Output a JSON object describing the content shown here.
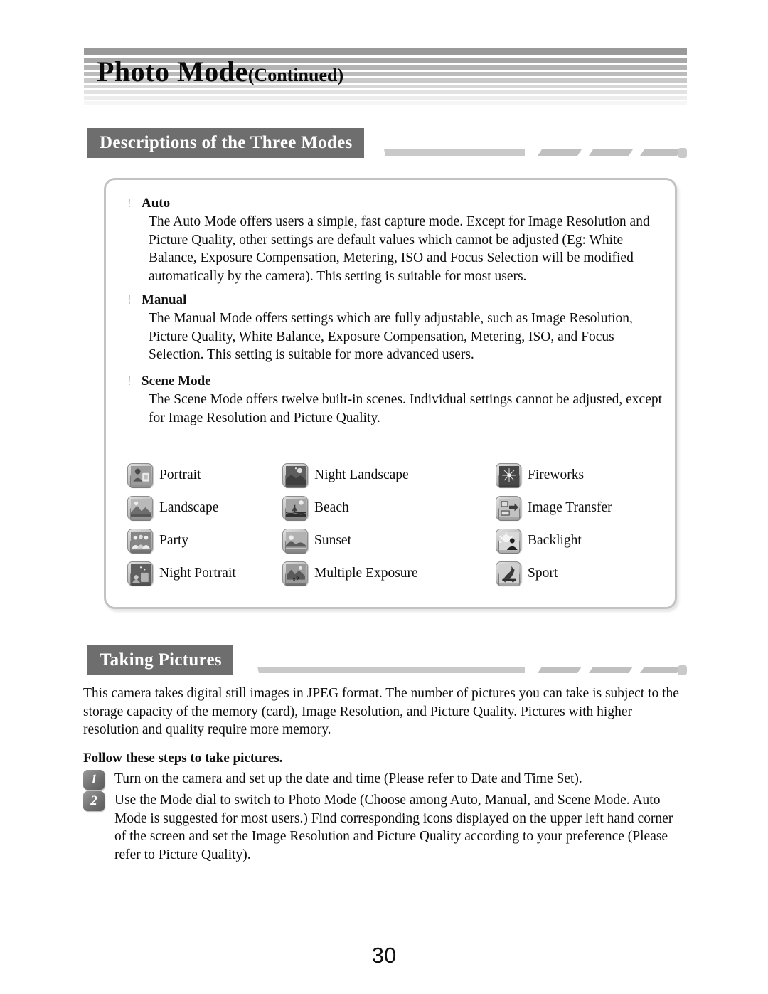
{
  "page": {
    "title_main": "Photo Mode",
    "title_sub": "(Continued)",
    "number": "30"
  },
  "sections": [
    {
      "id": "descriptions",
      "label": "Descriptions of the Three Modes"
    },
    {
      "id": "taking_pictures",
      "label": "Taking Pictures"
    }
  ],
  "modes": [
    {
      "marker": "!",
      "name": "Auto",
      "description": "The Auto Mode offers users a simple, fast capture mode. Except for Image Resolution and Picture Quality, other settings are default values which cannot be adjusted (Eg: White Balance, Exposure Compensation, Metering, ISO and Focus Selection will be modified automatically by the camera). This setting is suitable for most users."
    },
    {
      "marker": "!",
      "name": "Manual",
      "description": "The Manual Mode offers settings which are fully adjustable, such as Image Resolution, Picture Quality, White Balance, Exposure Compensation, Metering, ISO, and Focus Selection. This setting is suitable for more advanced users."
    },
    {
      "marker": "!",
      "name": "Scene Mode",
      "description": "The Scene Mode offers twelve built-in scenes. Individual settings cannot be adjusted, except for Image Resolution and Picture Quality."
    }
  ],
  "scene_icons": {
    "columns": [
      [
        {
          "icon": "portrait-scene-icon",
          "label": "Portrait"
        },
        {
          "icon": "landscape-scene-icon",
          "label": "Landscape"
        },
        {
          "icon": "party-scene-icon",
          "label": "Party"
        },
        {
          "icon": "night-portrait-scene-icon",
          "label": "Night Portrait"
        }
      ],
      [
        {
          "icon": "night-landscape-scene-icon",
          "label": "Night Landscape"
        },
        {
          "icon": "beach-scene-icon",
          "label": "Beach"
        },
        {
          "icon": "sunset-scene-icon",
          "label": "Sunset"
        },
        {
          "icon": "multiple-exposure-scene-icon",
          "label": "Multiple Exposure"
        }
      ],
      [
        {
          "icon": "fireworks-scene-icon",
          "label": "Fireworks"
        },
        {
          "icon": "image-transfer-scene-icon",
          "label": "Image Transfer"
        },
        {
          "icon": "backlight-scene-icon",
          "label": "Backlight"
        },
        {
          "icon": "sport-scene-icon",
          "label": "Sport"
        }
      ]
    ]
  },
  "taking_pictures": {
    "intro": "This camera takes digital still images in JPEG format. The number of pictures you can take is subject to the storage capacity of the memory (card), Image Resolution, and Picture Quality. Pictures with higher resolution and quality require more memory.",
    "steps_lead": "Follow these steps to take pictures.",
    "steps": [
      {
        "num": "1",
        "text": "Turn on the camera and set up the date and time (Please refer to Date and Time Set)."
      },
      {
        "num": "2",
        "text": "Use the Mode dial to switch to Photo Mode (Choose among Auto, Manual, and Scene Mode. Auto Mode is suggested for most users.) Find corresponding icons displayed on the upper left hand corner of the screen and set the Image Resolution and Picture Quality according to your preference (Please refer to Picture Quality)."
      }
    ]
  },
  "colors": {
    "header_bar": "#6e6e6e",
    "deco": "#c9c9c9",
    "panel_border": "#c3c3c3",
    "stripe_dark": "#9a9a9a"
  }
}
